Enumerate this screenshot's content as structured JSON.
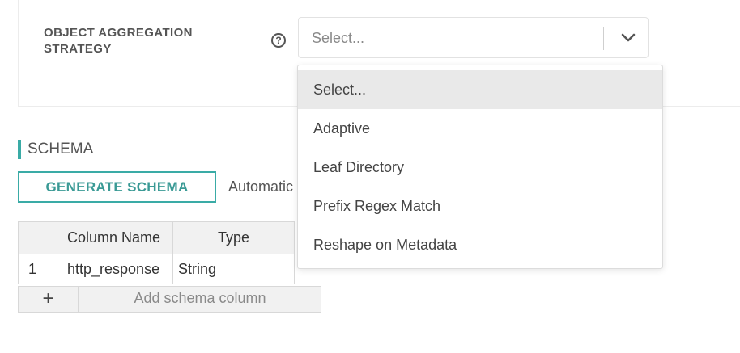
{
  "aggregation": {
    "label": "OBJECT AGGREGATION STRATEGY",
    "help_icon": "question-circle-icon",
    "select": {
      "placeholder": "Select...",
      "chevron_icon": "chevron-down-icon"
    },
    "options": [
      "Select...",
      "Adaptive",
      "Leaf Directory",
      "Prefix Regex Match",
      "Reshape on Metadata"
    ],
    "highlighted_option": "Select..."
  },
  "schema": {
    "title": "SCHEMA",
    "generate_button": "GENERATE SCHEMA",
    "auto_text": "Automatic",
    "table": {
      "headers": [
        "",
        "Column Name",
        "Type"
      ],
      "rows": [
        {
          "index": "1",
          "name": "http_response",
          "type": "String"
        }
      ]
    },
    "add_row": {
      "plus": "+",
      "label": "Add schema column"
    }
  },
  "colors": {
    "accent": "#3aaba6",
    "highlight": "#e9e9e9"
  }
}
